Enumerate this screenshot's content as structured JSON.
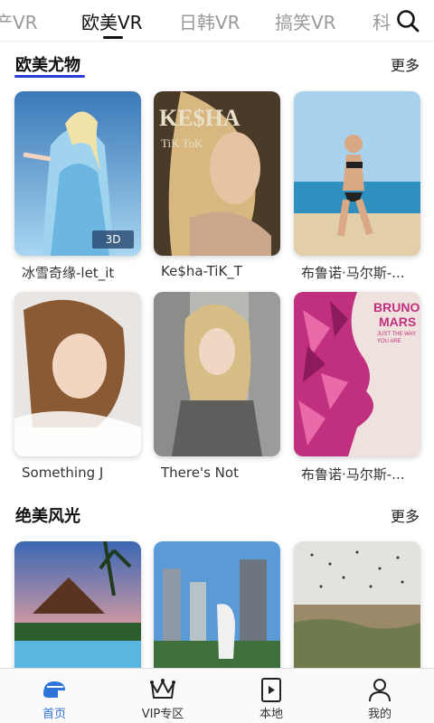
{
  "tabs": [
    {
      "label": "产VR"
    },
    {
      "label": "欧美VR"
    },
    {
      "label": "日韩VR"
    },
    {
      "label": "搞笑VR"
    },
    {
      "label": "科"
    }
  ],
  "sections": [
    {
      "title": "欧美尤物",
      "more": "更多",
      "items": [
        {
          "label": "冰雪奇缘-let_it",
          "badge": "3D"
        },
        {
          "label": "Ke$ha-TiK_T"
        },
        {
          "label": "布鲁诺·马尔斯-..."
        },
        {
          "label": "Something J"
        },
        {
          "label": "There's Not"
        },
        {
          "label": "布鲁诺·马尔斯-..."
        }
      ]
    },
    {
      "title": "绝美风光",
      "more": "更多",
      "items": [
        {},
        {},
        {}
      ]
    }
  ],
  "album_text": {
    "kesha_title": "KE$HA",
    "kesha_subtitle": "TiK ToK",
    "bruno_title_1": "BRUNO",
    "bruno_title_2": "MARS",
    "bruno_sub_1": "JUST THE WAY",
    "bruno_sub_2": "YOU ARE"
  },
  "bottom_nav": [
    {
      "label": "首页",
      "icon": "home-icon",
      "active": true
    },
    {
      "label": "VIP专区",
      "icon": "crown-icon"
    },
    {
      "label": "本地",
      "icon": "video-file-icon"
    },
    {
      "label": "我的",
      "icon": "user-icon"
    }
  ],
  "colors": {
    "accent": "#2e73d8",
    "section_underline": "#2a3bd6"
  }
}
